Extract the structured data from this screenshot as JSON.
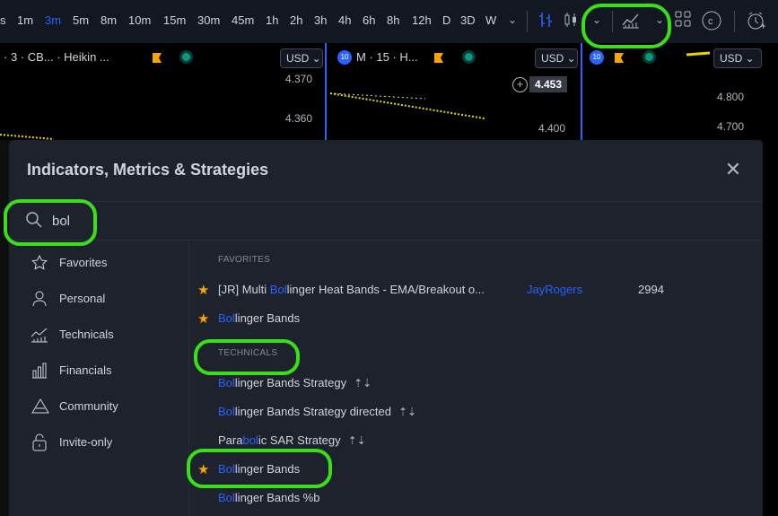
{
  "toolbar": {
    "timeframes": [
      "s",
      "1m",
      "3m",
      "5m",
      "8m",
      "10m",
      "15m",
      "30m",
      "45m",
      "1h",
      "2h",
      "3h",
      "4h",
      "6h",
      "8h",
      "12h",
      "D",
      "3D",
      "W"
    ],
    "active_timeframe": "3m"
  },
  "panes": [
    {
      "title": "· 3 · CB... · Heikin ...",
      "currency": "USD",
      "prices": [
        "4.370",
        "4.360"
      ]
    },
    {
      "title": "M · 15 · H...",
      "badge": "10",
      "currency": "USD",
      "prices": [
        "4.453",
        "4.400"
      ]
    },
    {
      "badge": "10",
      "currency": "USD",
      "prices": [
        "4.800",
        "4.700"
      ]
    }
  ],
  "dialog": {
    "title": "Indicators, Metrics & Strategies",
    "search_value": "bol",
    "sidebar": [
      "Favorites",
      "Personal",
      "Technicals",
      "Financials",
      "Community",
      "Invite-only"
    ],
    "sections": {
      "favorites": "FAVORITES",
      "technicals": "TECHNICALS"
    },
    "favorites": [
      {
        "pre": "[JR] Multi ",
        "match": "Bol",
        "post": "linger Heat Bands - EMA/Breakout o...",
        "author": "JayRogers",
        "likes": "2994"
      },
      {
        "pre": "",
        "match": "Bol",
        "post": "linger Bands",
        "author": "",
        "likes": ""
      }
    ],
    "technicals": [
      {
        "pre": "",
        "match": "Bol",
        "post": "linger Bands Strategy",
        "strategy": true,
        "starred": false
      },
      {
        "pre": "",
        "match": "Bol",
        "post": "linger Bands Strategy directed",
        "strategy": true,
        "starred": false
      },
      {
        "pre": "Para",
        "match": "bol",
        "post": "ic SAR Strategy",
        "strategy": true,
        "starred": false
      },
      {
        "pre": "",
        "match": "Bol",
        "post": "linger Bands",
        "strategy": false,
        "starred": true
      },
      {
        "pre": "",
        "match": "Bol",
        "post": "linger Bands %b",
        "strategy": false,
        "starred": false
      }
    ]
  },
  "colors": {
    "accent": "#2962ff",
    "star": "#f7a600",
    "annotation": "#39e017"
  }
}
